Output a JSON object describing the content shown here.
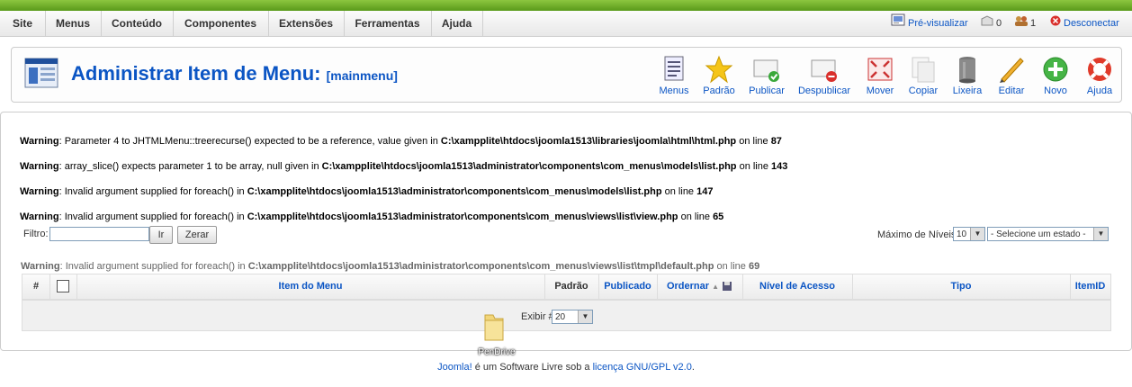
{
  "menubar": {
    "items": [
      "Site",
      "Menus",
      "Conteúdo",
      "Componentes",
      "Extensões",
      "Ferramentas",
      "Ajuda"
    ],
    "status": {
      "preview": "Pré-visualizar",
      "messages": "0",
      "users": "1",
      "logout": "Desconectar"
    }
  },
  "header": {
    "title": "Administrar Item de Menu:",
    "subtitle": "[mainmenu]"
  },
  "toolbar": {
    "buttons": [
      {
        "label": "Menus",
        "icon": "menus-icon"
      },
      {
        "label": "Padrão",
        "icon": "star-icon"
      },
      {
        "label": "Publicar",
        "icon": "publish-icon"
      },
      {
        "label": "Despublicar",
        "icon": "unpublish-icon"
      },
      {
        "label": "Mover",
        "icon": "move-icon"
      },
      {
        "label": "Copiar",
        "icon": "copy-icon"
      },
      {
        "label": "Lixeira",
        "icon": "trash-icon"
      },
      {
        "label": "Editar",
        "icon": "edit-icon"
      },
      {
        "label": "Novo",
        "icon": "new-icon"
      },
      {
        "label": "Ajuda",
        "icon": "help-icon"
      }
    ]
  },
  "warnings": [
    {
      "label": "Warning",
      "text": ": Parameter 4 to JHTMLMenu::treerecurse() expected to be a reference, value given in ",
      "path": "C:\\xampplite\\htdocs\\joomla1513\\libraries\\joomla\\html\\html.php",
      "online": " on line ",
      "line": "87"
    },
    {
      "label": "Warning",
      "text": ": array_slice() expects parameter 1 to be array, null given in ",
      "path": "C:\\xampplite\\htdocs\\joomla1513\\administrator\\components\\com_menus\\models\\list.php",
      "online": " on line ",
      "line": "143"
    },
    {
      "label": "Warning",
      "text": ": Invalid argument supplied for foreach() in ",
      "path": "C:\\xampplite\\htdocs\\joomla1513\\administrator\\components\\com_menus\\models\\list.php",
      "online": " on line ",
      "line": "147"
    },
    {
      "label": "Warning",
      "text": ": Invalid argument supplied for foreach() in ",
      "path": "C:\\xampplite\\htdocs\\joomla1513\\administrator\\components\\com_menus\\views\\list\\view.php",
      "online": " on line ",
      "line": "65"
    },
    {
      "label": "Warning",
      "text": ": Invalid argument supplied for foreach() in ",
      "path": "C:\\xampplite\\htdocs\\joomla1513\\administrator\\components\\com_menus\\views\\list\\tmpl\\default.php",
      "online": " on line ",
      "line": "69"
    }
  ],
  "filter": {
    "label": "Filtro:",
    "value": "",
    "go": "Ir",
    "reset": "Zerar",
    "max_levels_label": "Máximo de Níveis",
    "max_levels_value": "10",
    "state_value": "- Selecione um estado -"
  },
  "table": {
    "headers": {
      "num": "#",
      "item": "Item do Menu",
      "default": "Padrão",
      "published": "Publicado",
      "order": "Ordernar",
      "access": "Nível de Acesso",
      "type": "Tipo",
      "itemid": "ItemID"
    },
    "display_label": "Exibir #",
    "display_value": "20"
  },
  "desktop_icon_label": "PenDrive",
  "footer": {
    "link1": "Joomla!",
    "middle": " é um Software Livre sob a ",
    "link2": "licença GNU/GPL v2.0",
    "end": "."
  }
}
